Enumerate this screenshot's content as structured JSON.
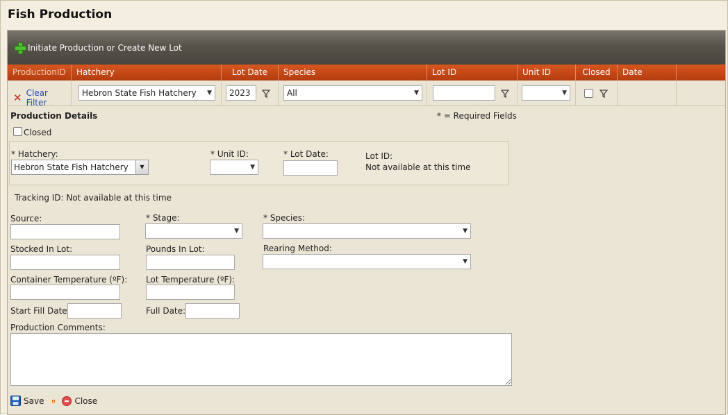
{
  "page": {
    "title": "Fish Production"
  },
  "toolbar": {
    "add_label": "Initiate Production or Create New Lot",
    "add_icon": "plus-icon"
  },
  "columns": [
    "ProductionID",
    "Hatchery",
    "Lot Date",
    "Species",
    "Lot ID",
    "Unit ID",
    "Closed",
    "Date Created"
  ],
  "filters": {
    "clear_label": "Clear Filter",
    "hatchery": "Hebron State Fish Hatchery",
    "lot_date": "2023",
    "species": "All",
    "lot_id": "",
    "unit_id": ""
  },
  "details": {
    "section_title": "Production Details",
    "required_note": "* = Required Fields",
    "closed_label": "Closed",
    "hatchery_label": "* Hatchery:",
    "hatchery_value": "Hebron State Fish Hatchery",
    "unit_id_label": "* Unit ID:",
    "lot_date_label": "* Lot Date:",
    "lot_id_label": "Lot ID:",
    "lot_id_value": "Not available at this time",
    "tracking": "Tracking ID: Not available at this time",
    "source_label": "Source:",
    "stage_label": "* Stage:",
    "species_label": "* Species:",
    "stocked_label": "Stocked In Lot:",
    "pounds_label": "Pounds In Lot:",
    "rearing_label": "Rearing Method:",
    "container_temp_label": "Container Temperature (ºF):",
    "lot_temp_label": "Lot Temperature (ºF):",
    "start_fill_label": "Start Fill Date:",
    "full_date_label": "Full Date:",
    "comments_label": "Production Comments:"
  },
  "actions": {
    "save_label": "Save",
    "close_label": "Close"
  },
  "colors": {
    "header": "#c4471a",
    "toolbar": "#57534b",
    "link": "#1f4fb5"
  }
}
